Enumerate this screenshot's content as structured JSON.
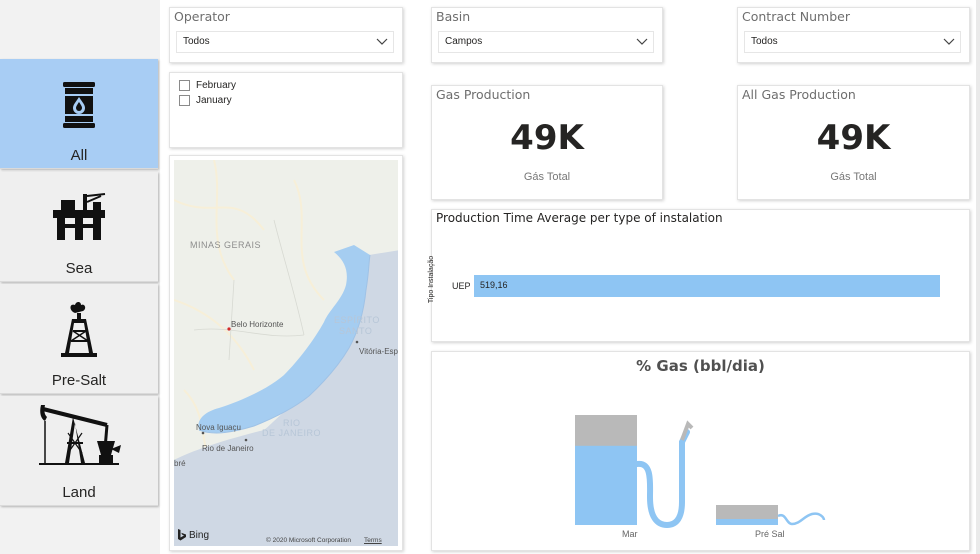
{
  "nav": {
    "items": [
      {
        "label": "All",
        "icon": "oil-barrel-icon",
        "active": true
      },
      {
        "label": "Sea",
        "icon": "offshore-platform-icon",
        "active": false
      },
      {
        "label": "Pre-Salt",
        "icon": "oil-derrick-icon",
        "active": false
      },
      {
        "label": "Land",
        "icon": "pumpjack-icon",
        "active": false
      }
    ]
  },
  "filters": {
    "operator": {
      "title": "Operator",
      "value": "Todos"
    },
    "basin": {
      "title": "Basin",
      "value": "Campos"
    },
    "contract": {
      "title": "Contract Number",
      "value": "Todos"
    },
    "months": [
      "February",
      "January"
    ]
  },
  "kpis": {
    "gas_production": {
      "title": "Gas Production",
      "value": "49K",
      "caption": "Gás Total"
    },
    "all_gas_production": {
      "title": "All Gas Production",
      "value": "49K",
      "caption": "Gás Total"
    }
  },
  "map": {
    "labels": {
      "state1": "MINAS GERAIS",
      "city1": "Belo Horizonte",
      "state2": "ESPÍRITO",
      "state2b": "SANTO",
      "city2": "Vitória-Espi",
      "city3": "Nova Iguaçu",
      "state3": "RIO",
      "state3b": "DE JANEIRO",
      "city4": "Rio de Janeiro",
      "city5": "bré"
    },
    "provider": "Bing",
    "copyright": "© 2020 Microsoft Corporation",
    "terms": "Terms"
  },
  "chart_data": [
    {
      "type": "bar",
      "title": "Production Time Average per type of instalation",
      "ylabel": "Tipo Instalação",
      "categories": [
        "UEP"
      ],
      "values": [
        519.16
      ],
      "value_labels": [
        "519,16"
      ],
      "orientation": "horizontal",
      "color": "#8ec5f3"
    }
  ],
  "gas_panel": {
    "title": "% Gas (bbl/dia)",
    "pumps": [
      {
        "label": "Mar",
        "fill": 0.72
      },
      {
        "label": "Pré Sal",
        "fill": 0.1
      }
    ],
    "fill_color": "#8ec5f3",
    "empty_color": "#b9b9b9"
  }
}
